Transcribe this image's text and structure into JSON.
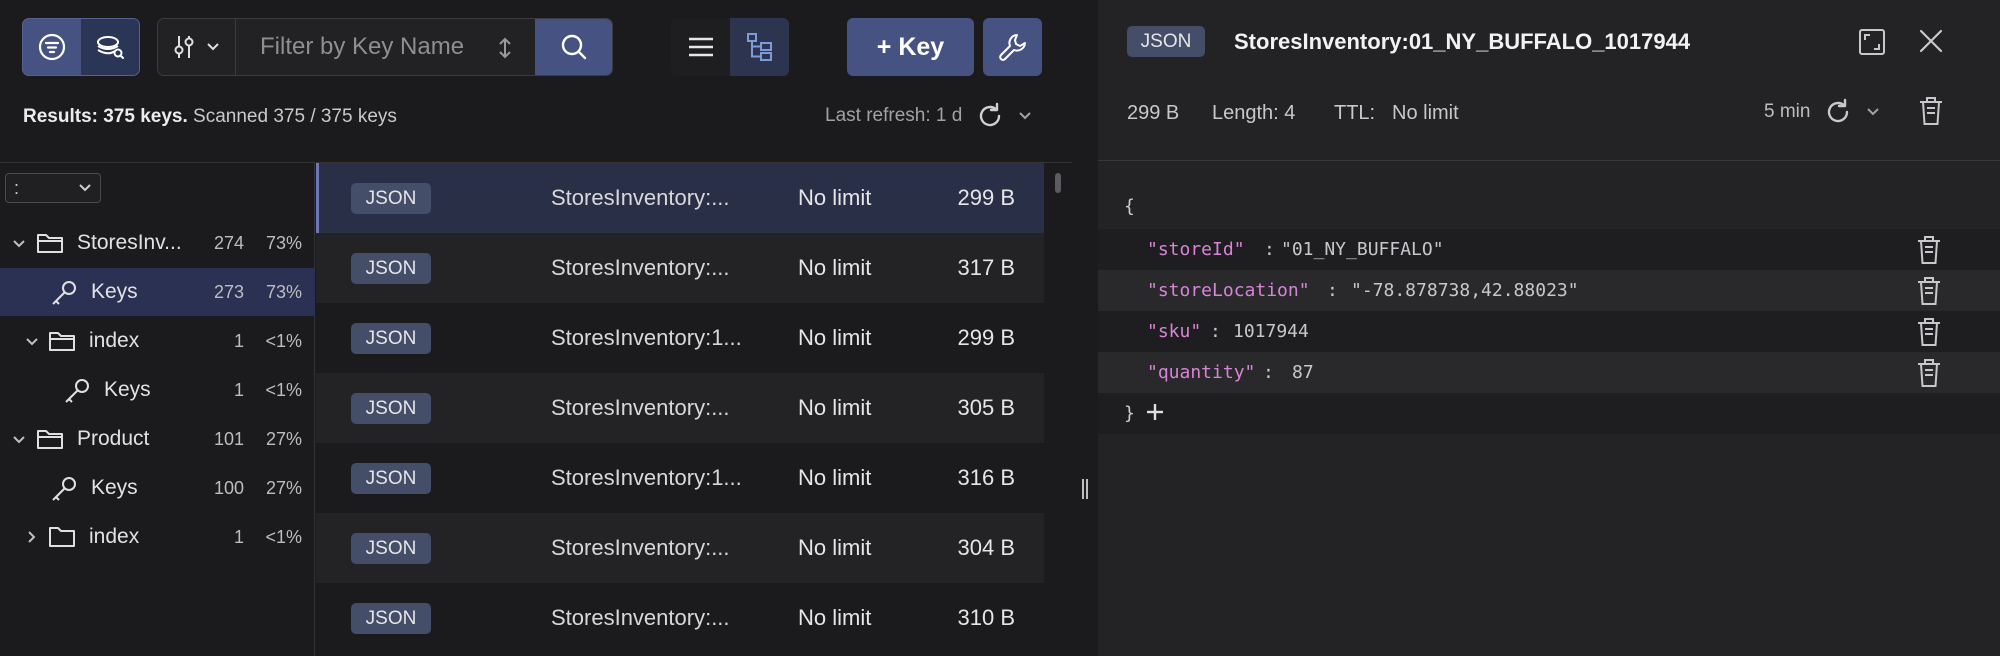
{
  "toolbar": {
    "filter_placeholder": "Filter by Key Name",
    "add_key_label": "+ Key"
  },
  "results": {
    "label": "Results: 375 keys.",
    "scanned": "Scanned 375 / 375 keys"
  },
  "refresh": {
    "label": "Last refresh: 1 d"
  },
  "tree": {
    "delimiter": ":",
    "nodes": [
      {
        "name": "StoresInv...",
        "count": "274",
        "pct": "73%"
      },
      {
        "name": "Keys",
        "count": "273",
        "pct": "73%"
      },
      {
        "name": "index",
        "count": "1",
        "pct": "<1%"
      },
      {
        "name": "Keys",
        "count": "1",
        "pct": "<1%"
      },
      {
        "name": "Product",
        "count": "101",
        "pct": "27%"
      },
      {
        "name": "Keys",
        "count": "100",
        "pct": "27%"
      },
      {
        "name": "index",
        "count": "1",
        "pct": "<1%"
      }
    ]
  },
  "keys": [
    {
      "type": "JSON",
      "name": "StoresInventory:...",
      "ttl": "No limit",
      "size": "299 B"
    },
    {
      "type": "JSON",
      "name": "StoresInventory:...",
      "ttl": "No limit",
      "size": "317 B"
    },
    {
      "type": "JSON",
      "name": "StoresInventory:1...",
      "ttl": "No limit",
      "size": "299 B"
    },
    {
      "type": "JSON",
      "name": "StoresInventory:...",
      "ttl": "No limit",
      "size": "305 B"
    },
    {
      "type": "JSON",
      "name": "StoresInventory:1...",
      "ttl": "No limit",
      "size": "316 B"
    },
    {
      "type": "JSON",
      "name": "StoresInventory:...",
      "ttl": "No limit",
      "size": "304 B"
    },
    {
      "type": "JSON",
      "name": "StoresInventory:...",
      "ttl": "No limit",
      "size": "310 B"
    }
  ],
  "details": {
    "type": "JSON",
    "key_name": "StoresInventory:01_NY_BUFFALO_1017944",
    "size": "299 B",
    "length": "Length: 4",
    "ttl_label": "TTL:",
    "ttl": "No limit",
    "refresh_interval": "5 min",
    "json": {
      "open": "{",
      "close": "}",
      "fields": [
        {
          "key": "\"storeId\"",
          "value": "\"01_NY_BUFFALO\"",
          "kind": "string"
        },
        {
          "key": "\"storeLocation\"",
          "value": "\"-78.878738,42.88023\"",
          "kind": "string"
        },
        {
          "key": "\"sku\"",
          "value": "1017944",
          "kind": "number"
        },
        {
          "key": "\"quantity\"",
          "value": "87",
          "kind": "number"
        }
      ]
    }
  },
  "colors": {
    "primary": "#465282",
    "badge": "#454e69",
    "json_key": "#d884d8",
    "json_string": "#99c77a",
    "json_number": "#5fa8df"
  }
}
